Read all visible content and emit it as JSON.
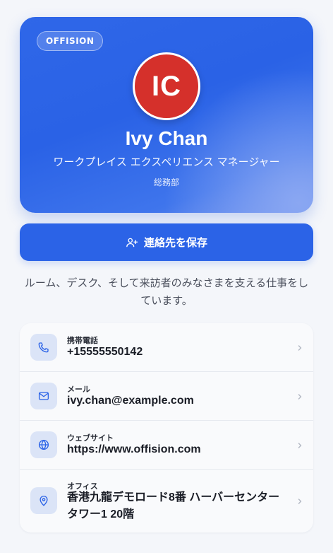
{
  "profile": {
    "brand": "OFFISION",
    "initials": "IC",
    "name": "Ivy Chan",
    "title": "ワークプレイス エクスペリエンス マネージャー",
    "department": "総務部",
    "avatar_color": "#d5302b"
  },
  "actions": {
    "save_contact_label": "連絡先を保存"
  },
  "bio": "ルーム、デスク、そして来訪者のみなさまを支える仕事をしています。",
  "contacts": [
    {
      "icon": "phone-icon",
      "label": "携帯電話",
      "value": "+15555550142"
    },
    {
      "icon": "mail-icon",
      "label": "メール",
      "value": "ivy.chan@example.com"
    },
    {
      "icon": "globe-icon",
      "label": "ウェブサイト",
      "value": "https://www.offision.com"
    },
    {
      "icon": "location-pin-icon",
      "label": "オフィス",
      "value": "香港九龍デモロード8番 ハーバーセンター タワー1 20階"
    }
  ],
  "colors": {
    "accent": "#2b63e7",
    "icon_bg": "#dbe4f7"
  }
}
